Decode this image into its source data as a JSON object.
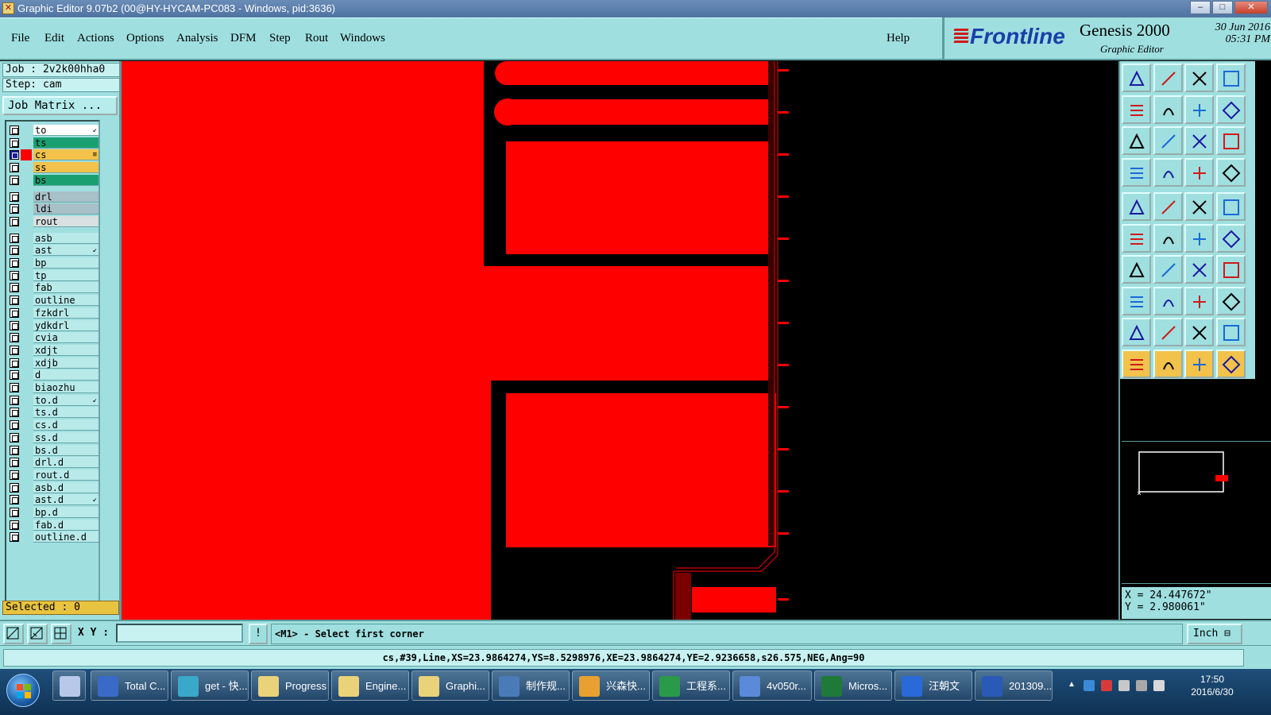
{
  "window": {
    "title": "Graphic Editor 9.07b2 (00@HY-HYCAM-PC083 - Windows, pid:3636)",
    "controls": [
      "–",
      "□",
      "✕"
    ]
  },
  "menu": {
    "items": [
      "File",
      "Edit",
      "Actions",
      "Options",
      "Analysis",
      "DFM",
      "Step",
      "Rout",
      "Windows"
    ],
    "help": "Help"
  },
  "brand": {
    "logo_text": "Frontline",
    "product": "Genesis 2000",
    "subtitle": "Graphic Editor",
    "date": "30 Jun 2016",
    "time": "05:31 PM"
  },
  "job": {
    "job_line": "Job : 2v2k00hha0",
    "step_line": "Step: cam",
    "job_matrix": "Job Matrix ..."
  },
  "layers": [
    {
      "name": "to",
      "color": "#ffffff",
      "mark": "↙",
      "checked": false
    },
    {
      "name": "ts",
      "color": "#1aa070",
      "mark": "",
      "checked": false
    },
    {
      "name": "cs",
      "color": "#f2c24a",
      "mark": "≡",
      "checked": true,
      "active_color": "#ff0000"
    },
    {
      "name": "ss",
      "color": "#f2c24a",
      "mark": "",
      "checked": false
    },
    {
      "name": "bs",
      "color": "#1aa070",
      "mark": "",
      "checked": false
    },
    {
      "name": "drl",
      "color": "#a8c0c8",
      "mark": "",
      "checked": false
    },
    {
      "name": "ldi",
      "color": "#a8c0c8",
      "mark": "",
      "checked": false
    },
    {
      "name": "rout",
      "color": "#d8e0e0",
      "mark": "",
      "checked": false
    },
    {
      "name": "asb",
      "color": "#b8eaea",
      "mark": "",
      "checked": false
    },
    {
      "name": "ast",
      "color": "#b8eaea",
      "mark": "↙",
      "checked": false
    },
    {
      "name": "bp",
      "color": "#b8eaea",
      "mark": "",
      "checked": false
    },
    {
      "name": "tp",
      "color": "#b8eaea",
      "mark": "",
      "checked": false
    },
    {
      "name": "fab",
      "color": "#b8eaea",
      "mark": "",
      "checked": false
    },
    {
      "name": "outline",
      "color": "#b8eaea",
      "mark": "",
      "checked": false
    },
    {
      "name": "fzkdrl",
      "color": "#b8eaea",
      "mark": "",
      "checked": false
    },
    {
      "name": "ydkdrl",
      "color": "#b8eaea",
      "mark": "",
      "checked": false
    },
    {
      "name": "cvia",
      "color": "#b8eaea",
      "mark": "",
      "checked": false
    },
    {
      "name": "xdjt",
      "color": "#b8eaea",
      "mark": "",
      "checked": false
    },
    {
      "name": "xdjb",
      "color": "#b8eaea",
      "mark": "",
      "checked": false
    },
    {
      "name": "d",
      "color": "#b8eaea",
      "mark": "",
      "checked": false
    },
    {
      "name": "biaozhu",
      "color": "#b8eaea",
      "mark": "",
      "checked": false
    },
    {
      "name": "to.d",
      "color": "#b8eaea",
      "mark": "↙",
      "checked": false
    },
    {
      "name": "ts.d",
      "color": "#b8eaea",
      "mark": "",
      "checked": false
    },
    {
      "name": "cs.d",
      "color": "#b8eaea",
      "mark": "",
      "checked": false
    },
    {
      "name": "ss.d",
      "color": "#b8eaea",
      "mark": "",
      "checked": false
    },
    {
      "name": "bs.d",
      "color": "#b8eaea",
      "mark": "",
      "checked": false
    },
    {
      "name": "drl.d",
      "color": "#b8eaea",
      "mark": "",
      "checked": false
    },
    {
      "name": "rout.d",
      "color": "#b8eaea",
      "mark": "",
      "checked": false
    },
    {
      "name": "asb.d",
      "color": "#b8eaea",
      "mark": "",
      "checked": false
    },
    {
      "name": "ast.d",
      "color": "#b8eaea",
      "mark": "↙",
      "checked": false
    },
    {
      "name": "bp.d",
      "color": "#b8eaea",
      "mark": "",
      "checked": false
    },
    {
      "name": "fab.d",
      "color": "#b8eaea",
      "mark": "",
      "checked": false
    },
    {
      "name": "outline.d",
      "color": "#b8eaea",
      "mark": "",
      "checked": false
    }
  ],
  "selected_text": "Selected : 0",
  "coords": {
    "x": "X = 24.447672\"",
    "y": "Y = 2.980061\""
  },
  "bottom": {
    "xy_label": "X Y :",
    "xy_value": "",
    "prompt": "<M1> - Select first corner",
    "unit": "Inch ⊟",
    "status": "cs,#39,Line,XS=23.9864274,YS=8.5298976,XE=23.9864274,YE=2.9236658,s26.575,NEG,Ang=90"
  },
  "taskbar": {
    "tasks": [
      {
        "label": "Total C...",
        "icon_color": "#3a6ac8"
      },
      {
        "label": "get - 快...",
        "icon_color": "#3aa8c8"
      },
      {
        "label": "Progress",
        "icon_color": "#e9d27a"
      },
      {
        "label": "Engine...",
        "icon_color": "#e9d27a"
      },
      {
        "label": "Graphi...",
        "icon_color": "#e9d27a"
      },
      {
        "label": "制作规...",
        "icon_color": "#4a7ab8"
      },
      {
        "label": "兴森快...",
        "icon_color": "#e8a030"
      },
      {
        "label": "工程系...",
        "icon_color": "#2a9a4a"
      },
      {
        "label": "4v050r...",
        "icon_color": "#5a8ad8"
      },
      {
        "label": "Micros...",
        "icon_color": "#1f7a3a"
      },
      {
        "label": "汪朝文",
        "icon_color": "#2a6ad8"
      },
      {
        "label": "201309...",
        "icon_color": "#2a5ab8"
      }
    ],
    "time": "17:50",
    "date": "2016/6/30"
  },
  "colors": {
    "copper": "#ff0000",
    "panel": "#9fdfe0",
    "selected_layer": "#ff0000"
  }
}
